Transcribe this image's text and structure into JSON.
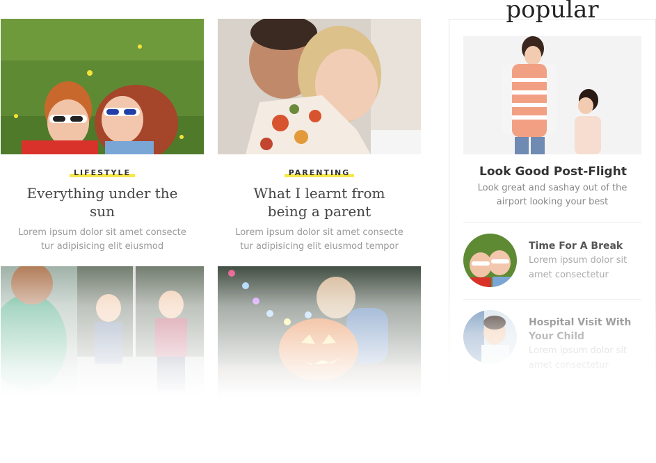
{
  "posts": [
    {
      "category": "LIFESTYLE",
      "title": "Everything under the sun",
      "excerpt": "Lorem ipsum dolor sit amet consecte tur adipisicing elit eiusmod"
    },
    {
      "category": "PARENTING",
      "title": "What I learnt from being a parent",
      "excerpt": "Lorem ipsum dolor sit amet consecte tur adipisicing elit eiusmod tempor"
    }
  ],
  "sidebar": {
    "heading": "popular",
    "featured": {
      "title": "Look Good Post-Flight",
      "excerpt": "Look great and sashay out of the airport looking your best"
    },
    "items": [
      {
        "title": "Time For A Break",
        "excerpt": "Lorem ipsum dolor sit amet consectetur"
      },
      {
        "title": "Hospital Visit With Your Child",
        "excerpt": "Lorem ipsum dolor sit amet consectetur"
      }
    ]
  },
  "colors": {
    "tag_highlight": "#f7e84c",
    "border": "#e4e4e4"
  }
}
